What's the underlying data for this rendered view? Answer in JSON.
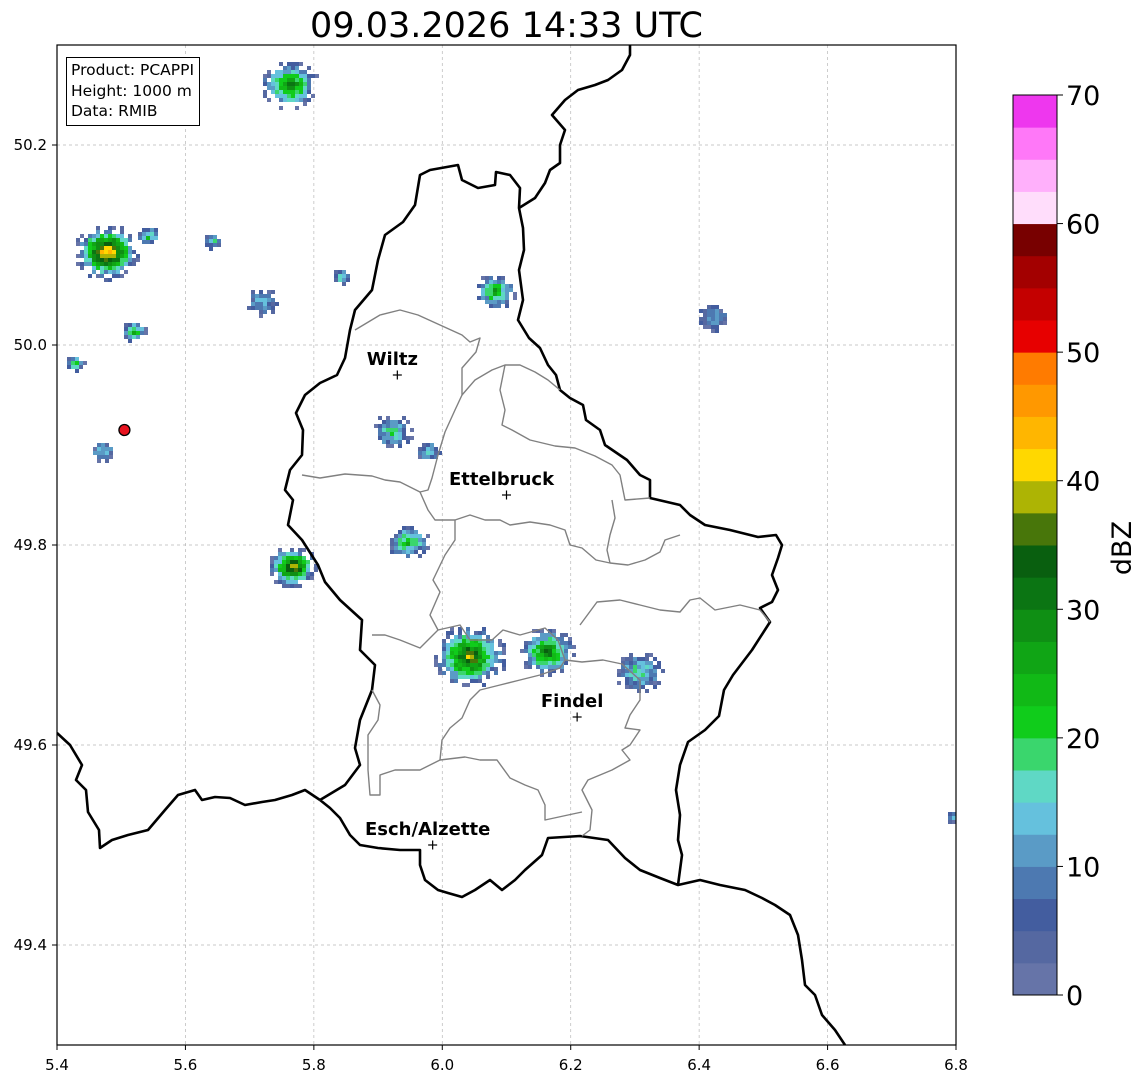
{
  "title": "09.03.2026 14:33 UTC",
  "info": {
    "product": "Product: PCAPPI",
    "height": "Height: 1000 m",
    "data": "Data: RMIB"
  },
  "map": {
    "lon_range": [
      5.4,
      6.8
    ],
    "lat_range": [
      49.3,
      50.3
    ],
    "x_ticks": [
      "5.4",
      "5.6",
      "5.8",
      "6.0",
      "6.2",
      "6.4",
      "6.6",
      "6.8"
    ],
    "y_ticks": [
      "49.4",
      "49.6",
      "49.8",
      "50.0",
      "50.2"
    ],
    "grid": true,
    "radar_site": {
      "lon": 5.505,
      "lat": 49.915,
      "color": "#e8131f"
    },
    "cities": [
      {
        "name": "Wiltz",
        "lon": 5.93,
        "lat": 49.97
      },
      {
        "name": "Ettelbruck",
        "lon": 6.1,
        "lat": 49.85
      },
      {
        "name": "Findel",
        "lon": 6.21,
        "lat": 49.628
      },
      {
        "name": "Esch/Alzette",
        "lon": 5.985,
        "lat": 49.5
      }
    ],
    "echoes": [
      {
        "lon": 5.76,
        "lat": 50.262,
        "r": 0.035,
        "max_dbz": 30
      },
      {
        "lon": 5.475,
        "lat": 50.095,
        "r": 0.04,
        "max_dbz": 45
      },
      {
        "lon": 5.54,
        "lat": 50.11,
        "r": 0.015,
        "max_dbz": 20
      },
      {
        "lon": 5.64,
        "lat": 50.105,
        "r": 0.012,
        "max_dbz": 15
      },
      {
        "lon": 5.517,
        "lat": 50.015,
        "r": 0.015,
        "max_dbz": 25
      },
      {
        "lon": 5.425,
        "lat": 49.983,
        "r": 0.012,
        "max_dbz": 22
      },
      {
        "lon": 5.47,
        "lat": 49.895,
        "r": 0.015,
        "max_dbz": 15
      },
      {
        "lon": 5.715,
        "lat": 50.045,
        "r": 0.02,
        "max_dbz": 12
      },
      {
        "lon": 5.84,
        "lat": 50.07,
        "r": 0.012,
        "max_dbz": 18
      },
      {
        "lon": 6.08,
        "lat": 50.055,
        "r": 0.025,
        "max_dbz": 25
      },
      {
        "lon": 6.42,
        "lat": 50.03,
        "r": 0.02,
        "max_dbz": 10
      },
      {
        "lon": 5.92,
        "lat": 49.915,
        "r": 0.025,
        "max_dbz": 18
      },
      {
        "lon": 5.975,
        "lat": 49.895,
        "r": 0.015,
        "max_dbz": 15
      },
      {
        "lon": 5.945,
        "lat": 49.805,
        "r": 0.025,
        "max_dbz": 24
      },
      {
        "lon": 5.765,
        "lat": 49.78,
        "r": 0.03,
        "max_dbz": 40
      },
      {
        "lon": 6.04,
        "lat": 49.69,
        "r": 0.045,
        "max_dbz": 38
      },
      {
        "lon": 6.16,
        "lat": 49.695,
        "r": 0.035,
        "max_dbz": 30
      },
      {
        "lon": 6.305,
        "lat": 49.675,
        "r": 0.03,
        "max_dbz": 17
      },
      {
        "lon": 6.795,
        "lat": 49.53,
        "r": 0.01,
        "max_dbz": 10
      }
    ]
  },
  "colorbar": {
    "label": "dBZ",
    "ticks": [
      "0",
      "10",
      "20",
      "30",
      "40",
      "50",
      "60",
      "70"
    ],
    "range": [
      0,
      70
    ],
    "step": 2.5,
    "colors": [
      "#6674a8",
      "#5568a1",
      "#435d9f",
      "#4d79b1",
      "#5a9bc6",
      "#65c1dd",
      "#5fd8c5",
      "#3ad66d",
      "#10cc1b",
      "#11b916",
      "#10a515",
      "#0f8f14",
      "#0b7513",
      "#095f0f",
      "#48760a",
      "#adb404",
      "#ffd800",
      "#ffb600",
      "#ff9800",
      "#ff7b00",
      "#e70000",
      "#c40000",
      "#a30000",
      "#780000",
      "#ffddfb",
      "#ffb0fb",
      "#ff78f8",
      "#ee37ee"
    ]
  }
}
